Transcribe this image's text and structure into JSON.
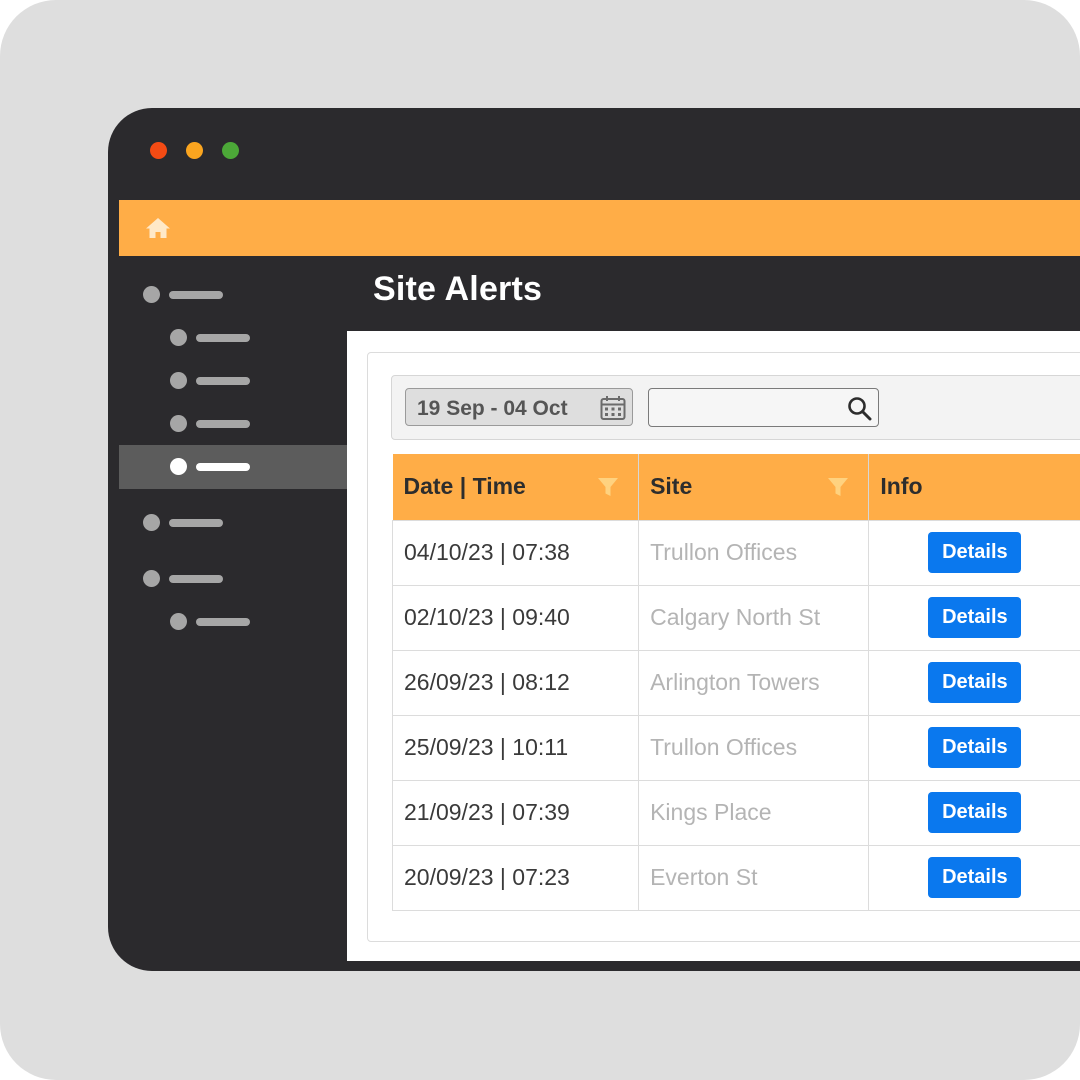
{
  "page": {
    "title": "Site Alerts"
  },
  "window": {
    "controls": [
      "close",
      "minimize",
      "maximize"
    ]
  },
  "topbar": {
    "icon": "home-icon",
    "color": "#ffad47"
  },
  "sidebar": {
    "items": [
      {
        "level": 0,
        "active": false
      },
      {
        "level": 1,
        "active": false
      },
      {
        "level": 1,
        "active": false
      },
      {
        "level": 1,
        "active": false
      },
      {
        "level": 1,
        "active": true
      },
      {
        "level": 0,
        "active": false
      },
      {
        "level": 0,
        "active": false
      },
      {
        "level": 1,
        "active": false
      }
    ]
  },
  "filters": {
    "date_range": "19 Sep - 04 Oct",
    "date_icon": "calendar-icon",
    "search": {
      "value": "",
      "placeholder": "",
      "icon": "search-icon"
    }
  },
  "table": {
    "columns": [
      {
        "label": "Date | Time",
        "filter": true
      },
      {
        "label": "Site",
        "filter": true
      },
      {
        "label": "Info",
        "filter": false
      }
    ],
    "rows": [
      {
        "datetime": "04/10/23 | 07:38",
        "site": "Trullon Offices",
        "action": "Details"
      },
      {
        "datetime": "02/10/23 | 09:40",
        "site": "Calgary North St",
        "action": "Details"
      },
      {
        "datetime": "26/09/23 | 08:12",
        "site": "Arlington Towers",
        "action": "Details"
      },
      {
        "datetime": "25/09/23 | 10:11",
        "site": "Trullon Offices",
        "action": "Details"
      },
      {
        "datetime": "21/09/23 | 07:39",
        "site": "Kings Place",
        "action": "Details"
      },
      {
        "datetime": "20/09/23 | 07:23",
        "site": "Everton St",
        "action": "Details"
      }
    ]
  },
  "colors": {
    "accent": "#ffad47",
    "button": "#0a78ee",
    "sidebar_bg": "#2b2a2d",
    "sidebar_active": "#5c5c5c"
  }
}
